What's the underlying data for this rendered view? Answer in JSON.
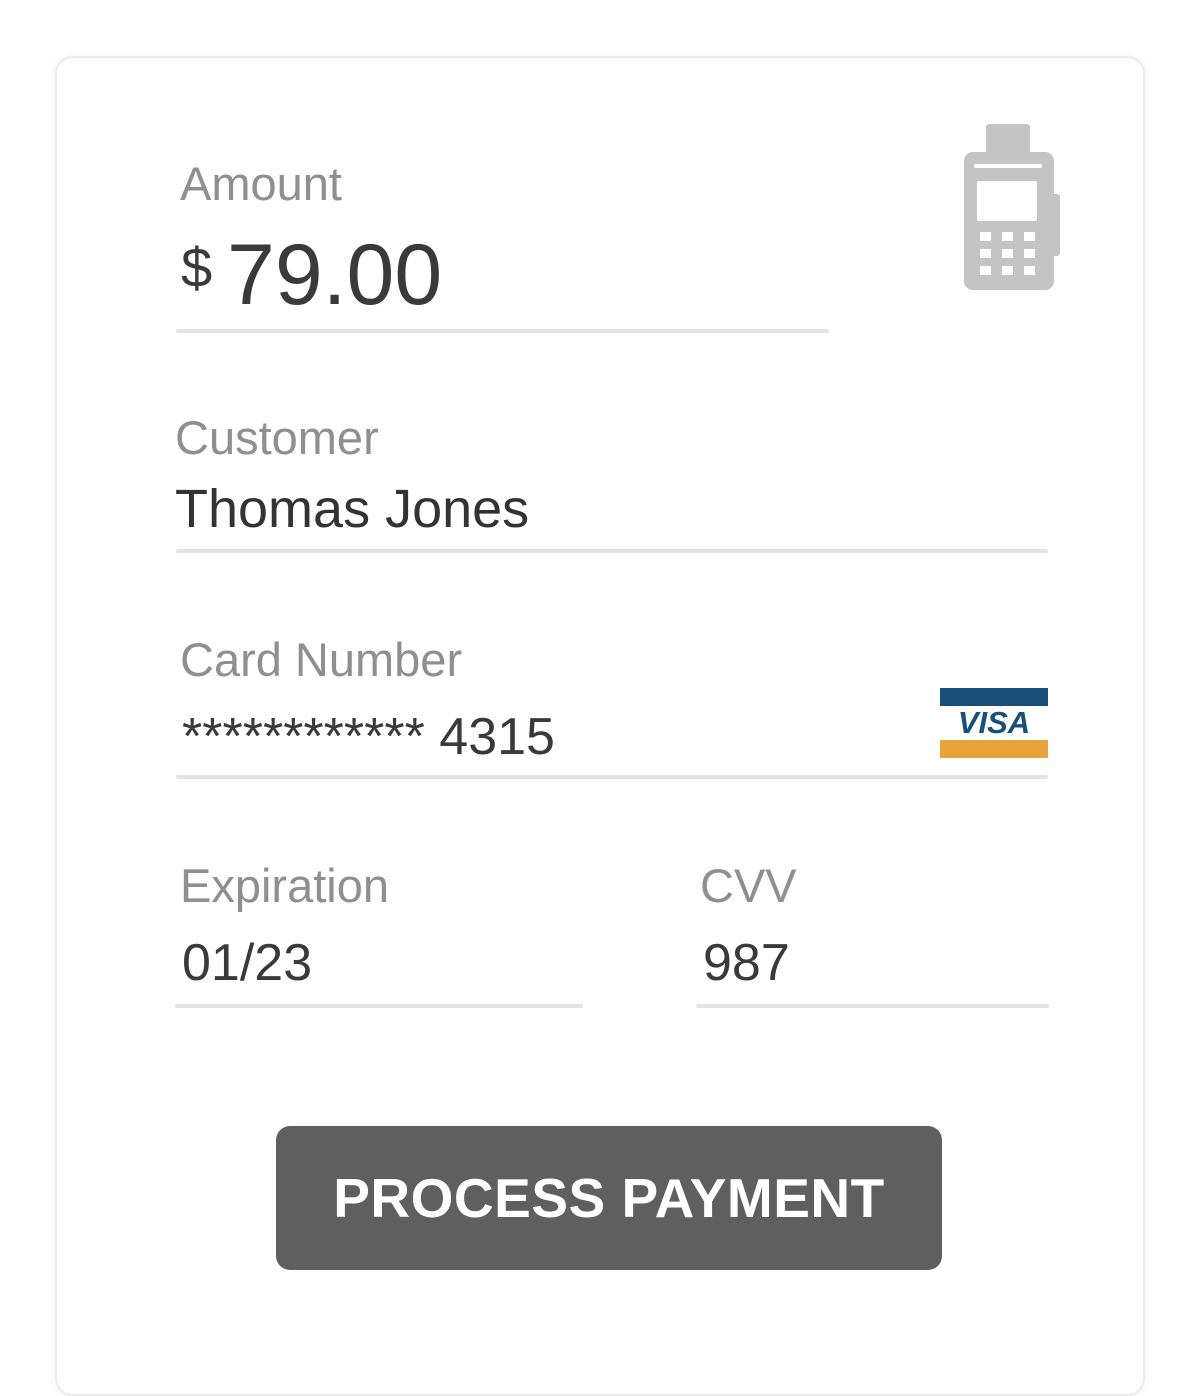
{
  "amount": {
    "label": "Amount",
    "currency_symbol": "$",
    "value": "79.00",
    "icon": "payment-terminal-icon"
  },
  "customer": {
    "label": "Customer",
    "value": "Thomas Jones"
  },
  "card": {
    "label": "Card Number",
    "masked_value": "************ 4315",
    "brand": "VISA",
    "brand_colors": {
      "top": "#1a4f7a",
      "bottom": "#e8a33a",
      "text": "#1a4f7a"
    }
  },
  "expiration": {
    "label": "Expiration",
    "value": "01/23"
  },
  "cvv": {
    "label": "CVV",
    "value": "987"
  },
  "actions": {
    "process_label": "PROCESS PAYMENT",
    "button_color": "#5f5f5f"
  }
}
